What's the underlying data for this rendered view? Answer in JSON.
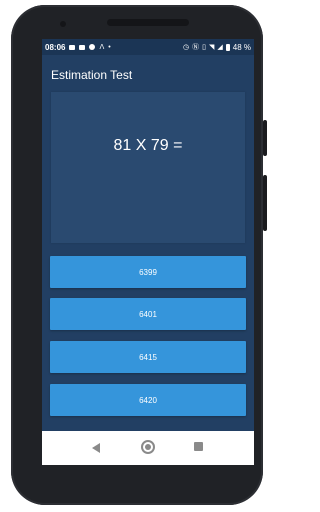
{
  "statusbar": {
    "time": "08:06",
    "battery": "48 %"
  },
  "app": {
    "title": "Estimation Test"
  },
  "question": {
    "text": "81 X 79 ="
  },
  "answers": [
    "6399",
    "6401",
    "6415",
    "6420"
  ],
  "navbar": {
    "back_icon": "back-triangle",
    "home_icon": "home-circle",
    "recents_icon": "recents-square"
  },
  "colors": {
    "background": "#223f63",
    "card": "#2a4a70",
    "button": "#3595db",
    "status_bar": "#1b3555"
  }
}
